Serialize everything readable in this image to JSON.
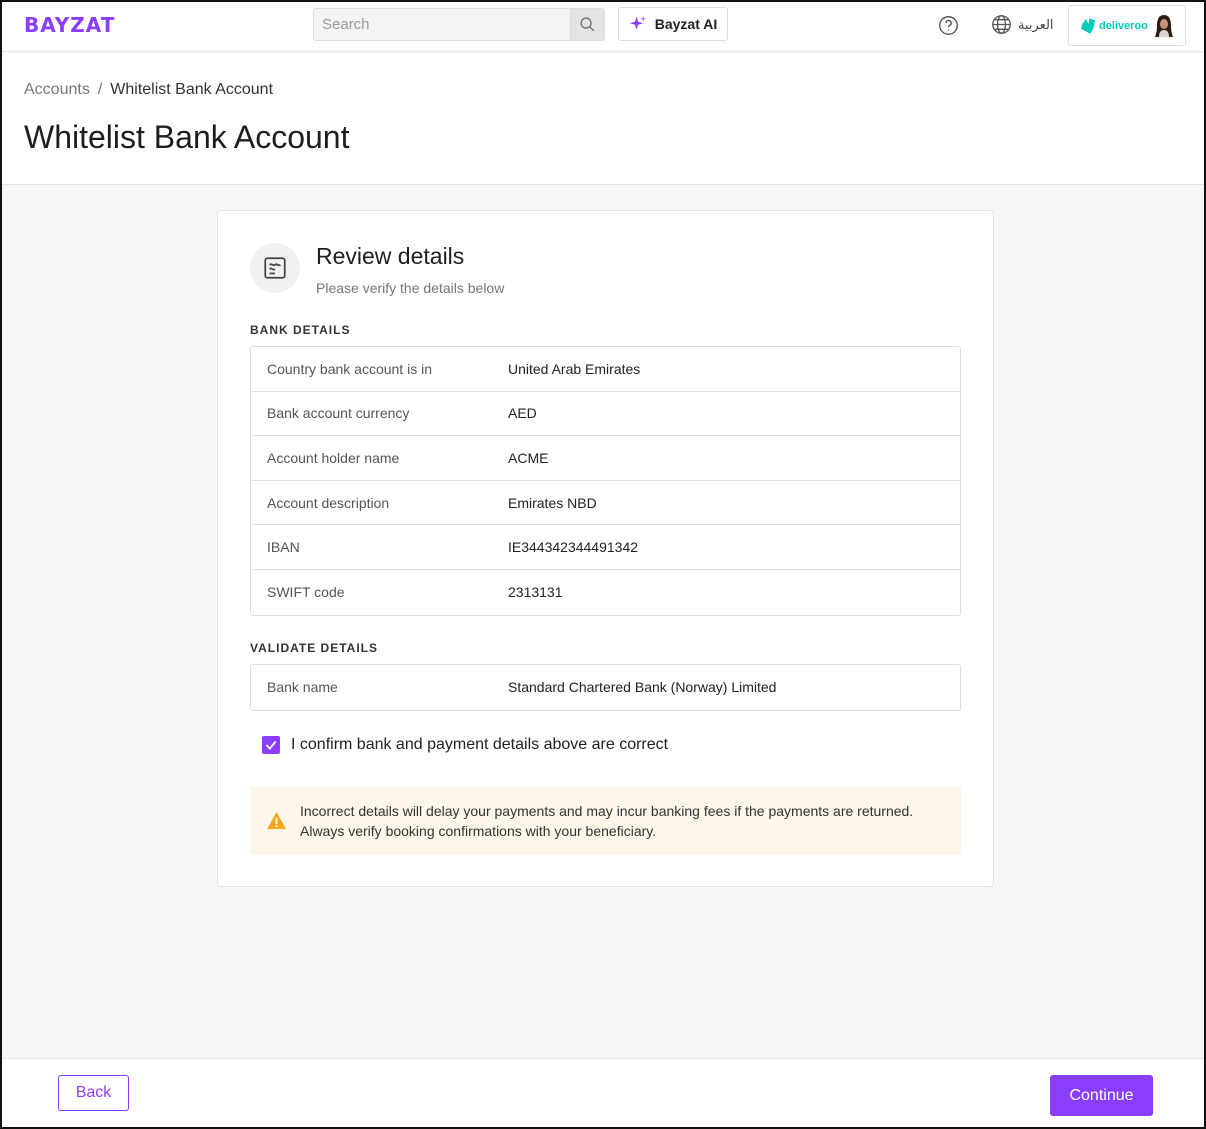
{
  "topbar": {
    "logo": "BAYZAT",
    "search_placeholder": "Search",
    "ai_button": "Bayzat AI",
    "language": "العربية",
    "company": "deliveroo"
  },
  "header": {
    "breadcrumb": [
      "Accounts",
      "Whitelist Bank Account"
    ],
    "title": "Whitelist Bank Account"
  },
  "card": {
    "title": "Review details",
    "subtitle": "Please verify the details below",
    "bank_section": "BANK DETAILS",
    "bank_rows": [
      {
        "label": "Country bank account is in",
        "value": "United Arab Emirates"
      },
      {
        "label": "Bank account currency",
        "value": "AED"
      },
      {
        "label": "Account holder name",
        "value": "ACME"
      },
      {
        "label": "Account description",
        "value": "Emirates NBD"
      },
      {
        "label": "IBAN",
        "value": "IE344342344491342"
      },
      {
        "label": "SWIFT code",
        "value": "2313131"
      }
    ],
    "validate_section": "VALIDATE DETAILS",
    "validate_rows": [
      {
        "label": "Bank name",
        "value": "Standard Chartered Bank (Norway) Limited"
      }
    ],
    "confirm_label": "I confirm bank and payment details above are correct",
    "confirm_checked": true,
    "warning_line1": "Incorrect details will delay your payments and may incur banking fees if the payments are returned.",
    "warning_line2": "Always verify booking confirmations with your beneficiary."
  },
  "footer": {
    "back": "Back",
    "continue": "Continue"
  },
  "colors": {
    "accent": "#8b3dff",
    "warning_bg": "#fdf6ea",
    "warning_icon": "#f5a623",
    "brand_deliveroo": "#00ccbc"
  }
}
